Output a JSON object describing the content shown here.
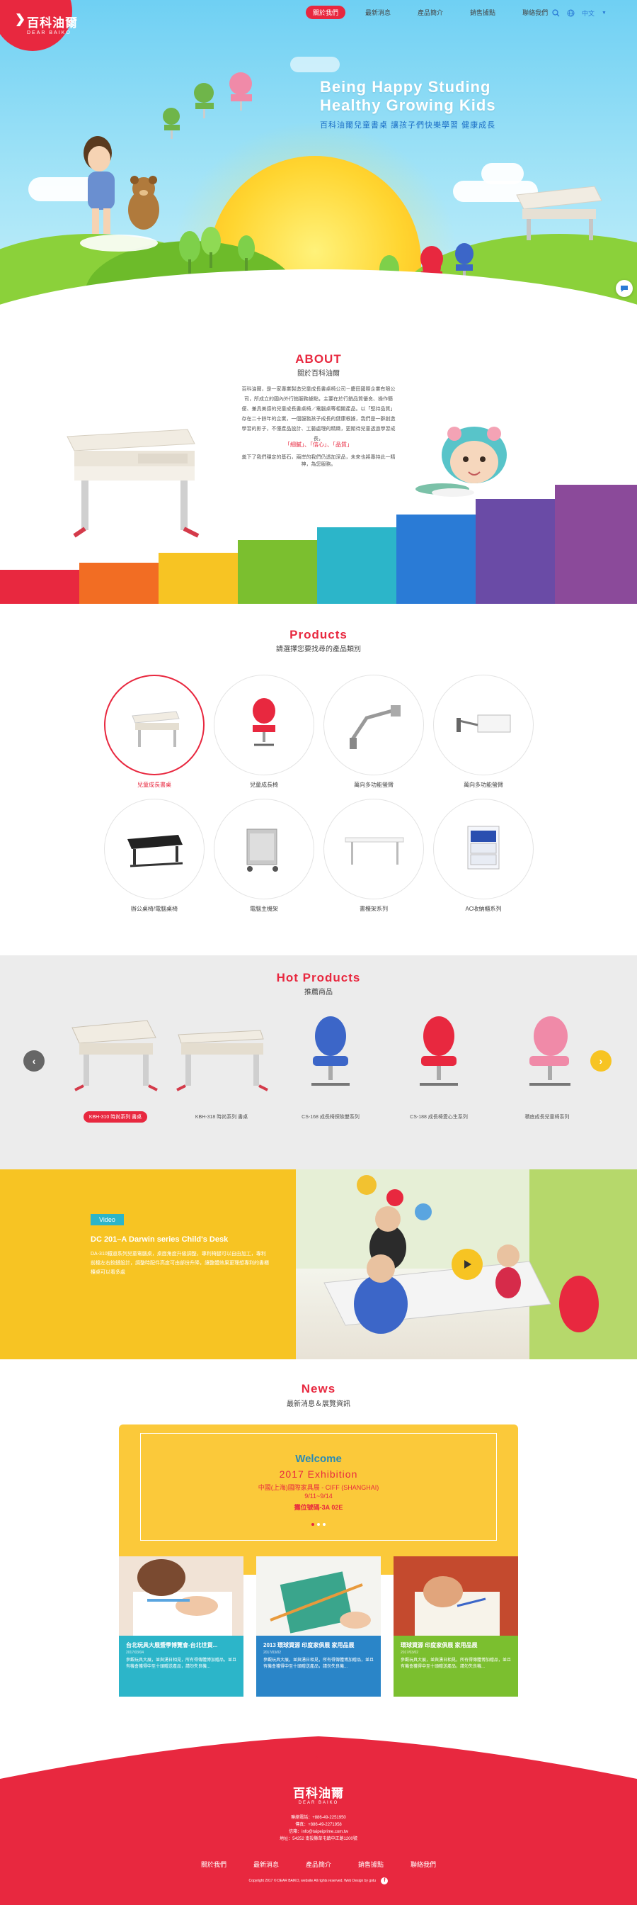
{
  "brand": {
    "name_zh": "百科油爾",
    "name_en": "DEAR BAIKO",
    "red": "#e8283f"
  },
  "nav": {
    "items": [
      {
        "label": "關於我們",
        "active": true
      },
      {
        "label": "最新消息",
        "active": false
      },
      {
        "label": "產品簡介",
        "active": false
      },
      {
        "label": "銷售據點",
        "active": false
      },
      {
        "label": "聯絡我們",
        "active": false
      }
    ],
    "language": "中文"
  },
  "hero": {
    "title_line1": "Being Happy Studing",
    "title_line2": "Healthy Growing Kids",
    "subtitle": "百科油爾兒童書桌  讓孩子們快樂學習 健康成長"
  },
  "about": {
    "title": "ABOUT",
    "subtitle": "關於百科油爾",
    "body": "百科油爾，是一家專業製造兒童成長書桌椅公司－慶田國際企業有限公司，所成立的國內外行銷服務據點，主要在於行銷品質優良、操作簡便、兼具美感的兒童成長書桌椅／電腦桌等相關產品。以「堅持品質」存在二十餘年的企業，一個服務孩子成長的健康根據，我們是一群創造學習的影子，不僅產品設計、工藝處理的精緻，更期待兒童透過學習成長，",
    "keywords": "「細膩」、「信心」、「品質」",
    "tail": "奠下了我們穩定的基石，兩岸的我們仍透加深品，未來也將專持此一精神，為您服務。"
  },
  "products": {
    "title": "Products",
    "subtitle": "請選擇您要找尋的產品類別",
    "items": [
      {
        "label": "兒童成長書桌",
        "selected": true
      },
      {
        "label": "兒童成長椅",
        "selected": false
      },
      {
        "label": "萬向多功能螢臂",
        "selected": false
      },
      {
        "label": "萬向多功能螢臂",
        "selected": false
      },
      {
        "label": "辦公桌椅/電腦桌椅",
        "selected": false
      },
      {
        "label": "電腦主機架",
        "selected": false
      },
      {
        "label": "書檯架系列",
        "selected": false
      },
      {
        "label": "AC收納櫃系列",
        "selected": false
      }
    ]
  },
  "hot": {
    "title": "Hot Products",
    "subtitle": "推薦商品",
    "items": [
      {
        "label": "KBH-310 時尚系列 書桌",
        "selected": true
      },
      {
        "label": "KBH-318 時尚系列 書桌",
        "selected": false
      },
      {
        "label": "CS-168 成長椅探險雙系列",
        "selected": false
      },
      {
        "label": "CS-188 成長椅愛心生系列",
        "selected": false
      },
      {
        "label": "積底成長兒童椅系列",
        "selected": false
      }
    ],
    "prev": "‹",
    "next": "›"
  },
  "video": {
    "tag": "Video",
    "title": "DC 201–A Darwin series Child's Desk",
    "desc": "DA-310鐵道系列兒童電腦桌，桌面角度升級調整，專利椅腿可以自由加工，專利前檔左右鉸鏈設計，調整時配件高度可由部份升降，讓整體效果更理想專利的書櫃檯桌可以看多處"
  },
  "news": {
    "title": "News",
    "subtitle": "最新消息＆展覽資訊",
    "banner": {
      "welcome": "Welcome",
      "exhibition": "2017 Exhibition",
      "city": "中國(上海)國際家具展 - CIFF (SHANGHAI)",
      "date": "9/11~9/14",
      "booth": "攤位號碼-3A 02E"
    },
    "cards": [
      {
        "title": "台北玩具大展暨學博覽會-台北世貿...",
        "date": "2017/03/04",
        "text": "參觀玩具大展，並與湧日相見，所有得傳體博加贈品，並且有機會獲得中至十頭贈送產品，請勿失良機...",
        "color": "#2cb5c9"
      },
      {
        "title": "2013 環球資源 印度家俱展 家用品展",
        "date": "2017/03/02",
        "text": "參觀玩具大展，並與湧日相見，所有得傳體博加贈品，並且有機會獲得中至十頭贈送產品，請勿失良機...",
        "color": "#2a85c8"
      },
      {
        "title": "環球資源 印度家俱展 家用品展",
        "date": "2017/03/02",
        "text": "參觀玩具大展，並與湧日相見，所有得傳體博加贈品，並且有機會獲得中至十頭贈送產品，請勿失良機...",
        "color": "#7bbf2f"
      }
    ]
  },
  "footer": {
    "logo_zh": "百科油爾",
    "logo_en": "DEAR BAIKO",
    "phone": "聯絡電話：+886-49-2251950",
    "fax": "傳真：+886-49-2271958",
    "email": "信箱：info@taipeiprime.com.tw",
    "address": "地址：54252 南投縣草屯鎮中正路1200號",
    "nav": [
      "關於我們",
      "最新消息",
      "產品簡介",
      "銷售據點",
      "聯絡我們"
    ],
    "copyright": "Copyright 2017 © DEAR BAIKO, website All rights reserved. Web Design by gotu"
  }
}
